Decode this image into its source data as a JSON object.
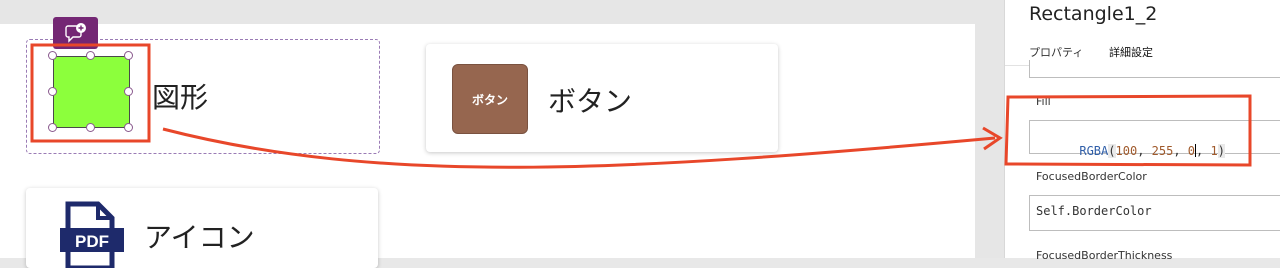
{
  "canvas": {
    "shape_card": {
      "label": "図形",
      "rect_color": "#8CFF3C",
      "selected": true
    },
    "button_card": {
      "button_text": "ボタン",
      "button_color": "#96664F",
      "label": "ボタン"
    },
    "icon_card": {
      "icon_text": "PDF",
      "label": "アイコン",
      "icon_color": "#1E2A6B"
    }
  },
  "panel": {
    "control_name": "Rectangle1_2",
    "tabs": [
      {
        "label": "プロパティ",
        "active": false
      },
      {
        "label": "詳細設定",
        "active": true
      }
    ],
    "properties": {
      "fill": {
        "name": "Fill",
        "formula_fn": "RGBA",
        "values": [
          "100",
          "255",
          "0",
          "1"
        ]
      },
      "focused_border_color": {
        "name": "FocusedBorderColor",
        "value": "Self.BorderColor"
      },
      "focused_border_thickness": {
        "name": "FocusedBorderThickness"
      }
    }
  },
  "annotation": {
    "color": "#E8472A"
  },
  "colors": {
    "accent": "#742774"
  }
}
